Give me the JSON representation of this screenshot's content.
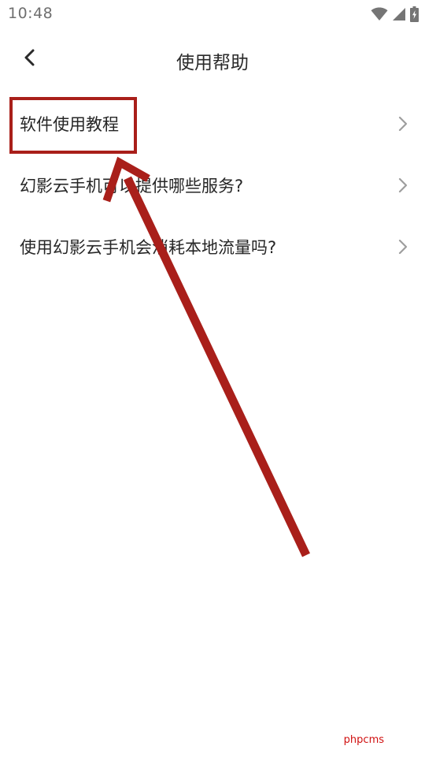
{
  "status_bar": {
    "time": "10:48",
    "icons": [
      "wifi-icon",
      "cell-signal-icon",
      "battery-charging-icon"
    ]
  },
  "header": {
    "title": "使用帮助",
    "back_icon": "chevron-left-icon"
  },
  "help_items": [
    {
      "label": "软件使用教程"
    },
    {
      "label": "幻影云手机可以提供哪些服务?"
    },
    {
      "label": "使用幻影云手机会消耗本地流量吗?"
    }
  ],
  "annotation": {
    "color": "#a91f1a",
    "highlights": "软件使用教程"
  },
  "watermark": {
    "text": "phpcms",
    "color": "#d01010"
  },
  "colors": {
    "background": "#ffffff",
    "text": "#262626",
    "chevron": "#9e9e9e",
    "status_icons": "#757575"
  }
}
